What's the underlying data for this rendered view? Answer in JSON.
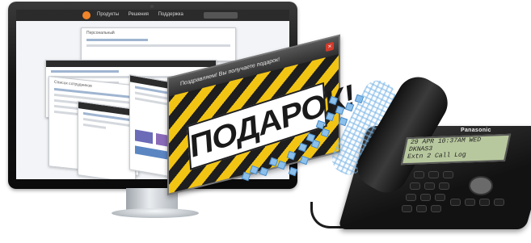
{
  "monitor": {
    "site_menu": [
      "Продукты",
      "Решения",
      "Поддержка"
    ]
  },
  "pages": [
    {
      "title": "Персональный"
    },
    {
      "title": "Список сотрудников"
    },
    {
      "title": ""
    }
  ],
  "banner": {
    "caption": "Поздравляем! Вы получаете подарок!",
    "close_icon": "close-icon",
    "headline": "ПОДАРОК!",
    "stripe_colors": [
      "#f2c414",
      "#1e1e1e"
    ]
  },
  "phone": {
    "brand": "Panasonic",
    "lcd_line1": "29 APR  10:37AM WED",
    "lcd_line2": "DKNAS3",
    "lcd_line3": "Extn 2 Call Log"
  },
  "colors": {
    "accent_orange": "#f0842a",
    "data_blue": "#8cc0ea"
  }
}
